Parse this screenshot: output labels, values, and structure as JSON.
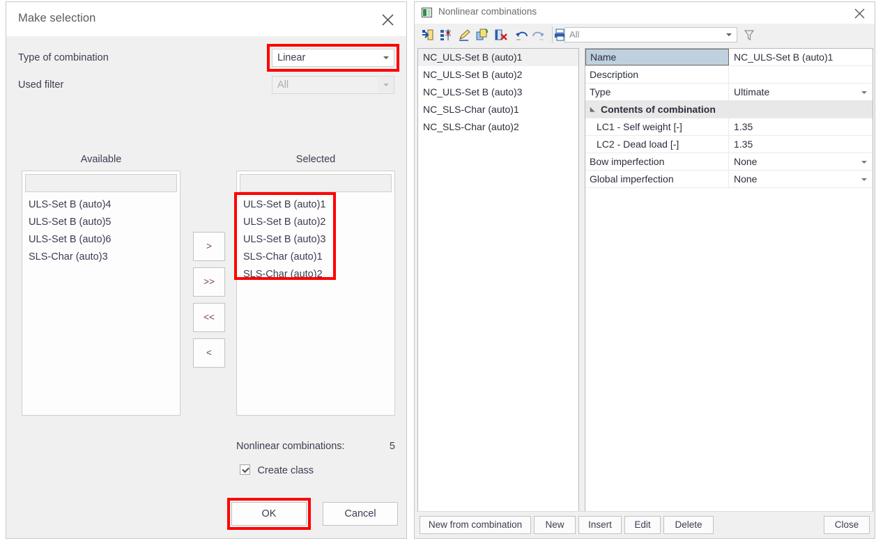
{
  "make_selection": {
    "title": "Make selection",
    "close_icon": "close-icon",
    "type_of_combination": {
      "label": "Type of combination",
      "value": "Linear"
    },
    "used_filter": {
      "label": "Used filter",
      "value": "All"
    },
    "available": {
      "caption": "Available",
      "search_value": "",
      "items": [
        "ULS-Set B (auto)4",
        "ULS-Set B (auto)5",
        "ULS-Set B (auto)6",
        "SLS-Char (auto)3"
      ]
    },
    "selected": {
      "caption": "Selected",
      "search_value": "",
      "items": [
        "ULS-Set B (auto)1",
        "ULS-Set B (auto)2",
        "ULS-Set B (auto)3",
        "SLS-Char (auto)1",
        "SLS-Char (auto)2"
      ]
    },
    "transfer_buttons": {
      "move_right": ">",
      "move_all_right": ">>",
      "move_all_left": "<<",
      "move_left": "<"
    },
    "count": {
      "label": "Nonlinear combinations:",
      "value": "5"
    },
    "create_class": {
      "label": "Create class",
      "checked": true
    },
    "ok_label": "OK",
    "cancel_label": "Cancel"
  },
  "nonlinear_combinations": {
    "title": "Nonlinear combinations",
    "close_icon": "close-icon",
    "toolbar": {
      "icons": [
        "new-combination-icon",
        "edit-layers-icon",
        "rename-pencil-icon",
        "copy-icon",
        "delete-icon",
        "undo-icon",
        "redo-icon",
        "print-icon"
      ],
      "filter_value": "All",
      "filter_icon": "funnel-filter-icon"
    },
    "list": {
      "items": [
        "NC_ULS-Set B (auto)1",
        "NC_ULS-Set B (auto)2",
        "NC_ULS-Set B (auto)3",
        "NC_SLS-Char (auto)1",
        "NC_SLS-Char (auto)2"
      ],
      "selected_index": 0
    },
    "properties": [
      {
        "name": "Name",
        "value": "NC_ULS-Set B (auto)1",
        "kind": "header-sel"
      },
      {
        "name": "Description",
        "value": "",
        "kind": "text"
      },
      {
        "name": "Type",
        "value": "Ultimate",
        "kind": "dropdown"
      },
      {
        "name": "Contents of combination",
        "value": "",
        "kind": "group"
      },
      {
        "name": "LC1 - Self weight [-]",
        "value": "1.35",
        "kind": "indent"
      },
      {
        "name": "LC2 - Dead load [-]",
        "value": "1.35",
        "kind": "indent"
      },
      {
        "name": "Bow imperfection",
        "value": "None",
        "kind": "dropdown"
      },
      {
        "name": "Global imperfection",
        "value": "None",
        "kind": "dropdown"
      }
    ],
    "buttons": {
      "new_from_combination": "New from combination",
      "new": "New",
      "insert": "Insert",
      "edit": "Edit",
      "delete": "Delete",
      "close": "Close"
    }
  },
  "annotations": {
    "highlight_color": "#ff0000"
  }
}
